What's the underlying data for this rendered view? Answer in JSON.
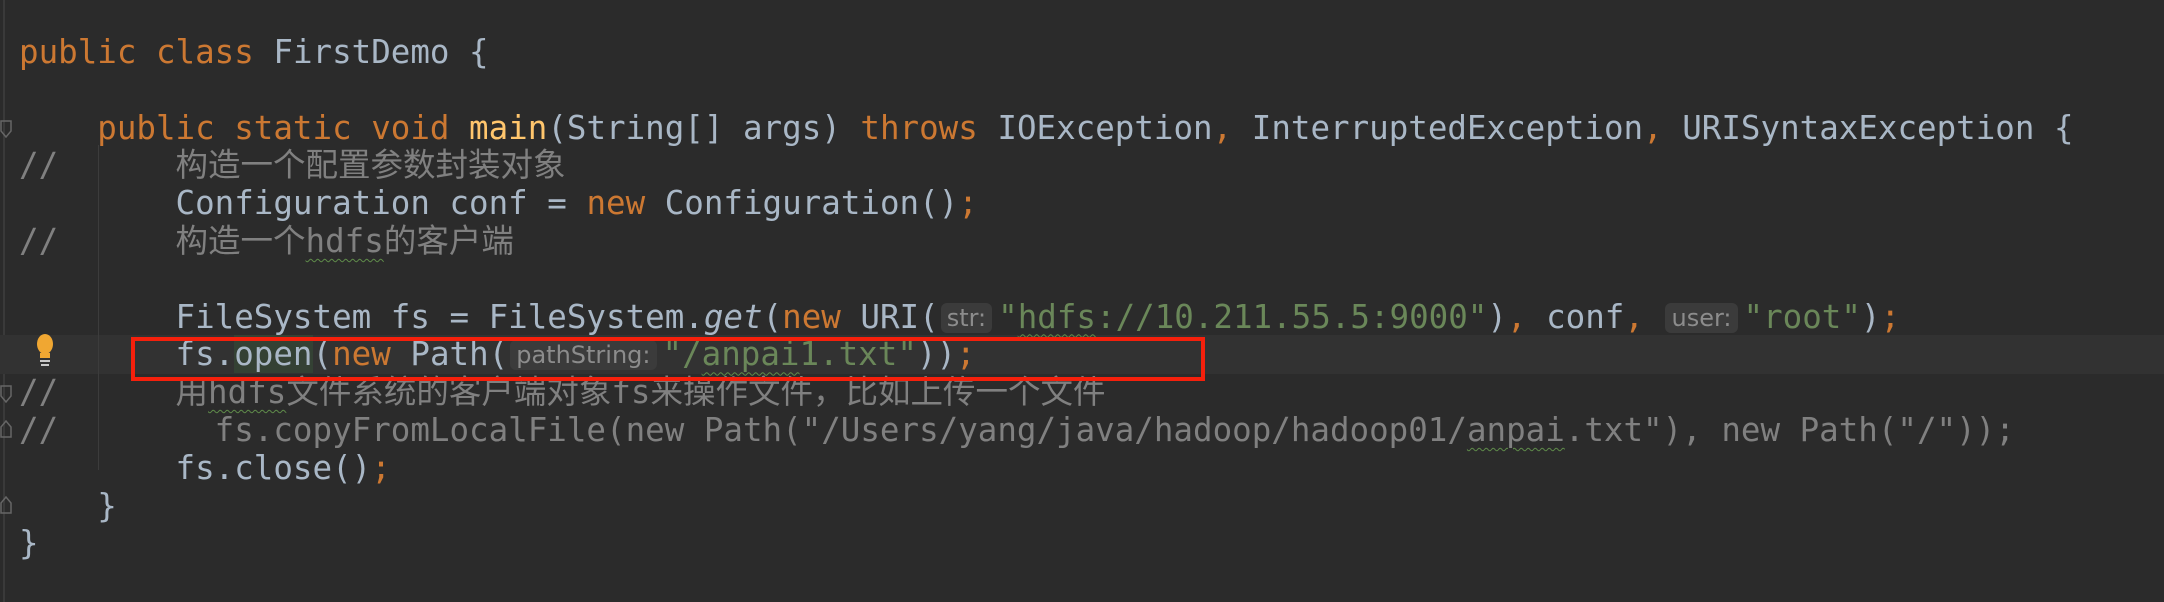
{
  "editor": {
    "colors": {
      "background": "#2b2b2b",
      "keyword": "#cc7832",
      "text": "#a9b7c6",
      "string": "#6a8759",
      "comment": "#808080",
      "method": "#ffc66d",
      "highlight_box": "#f5200c"
    },
    "lines": [
      {
        "tokens": [
          {
            "t": "public class ",
            "c": "kw"
          },
          {
            "t": "FirstDemo {"
          }
        ]
      },
      {
        "tokens": []
      },
      {
        "tokens": [
          {
            "t": "    public static void ",
            "c": "kw"
          },
          {
            "t": "main",
            "c": "fn"
          },
          {
            "t": "(String[] args) "
          },
          {
            "t": "throws ",
            "c": "kw"
          },
          {
            "t": "IOException"
          },
          {
            "t": ", ",
            "c": "kw"
          },
          {
            "t": "InterruptedException"
          },
          {
            "t": ", ",
            "c": "kw"
          },
          {
            "t": "URISyntaxException {"
          }
        ]
      },
      {
        "tokens": [
          {
            "t": "//      构造一个配置参数封装对象",
            "c": "cm"
          }
        ]
      },
      {
        "tokens": [
          {
            "t": "        Configuration conf = "
          },
          {
            "t": "new ",
            "c": "kw"
          },
          {
            "t": "Configuration()"
          },
          {
            "t": ";",
            "c": "kw"
          }
        ]
      },
      {
        "tokens": [
          {
            "t": "//      构造一个",
            "c": "cm"
          },
          {
            "t": "hdfs",
            "c": "cm typo"
          },
          {
            "t": "的客户端",
            "c": "cm"
          }
        ]
      },
      {
        "tokens": []
      },
      {
        "tokens": [
          {
            "t": "        FileSystem fs = FileSystem."
          },
          {
            "t": "get",
            "c": "it"
          },
          {
            "t": "("
          },
          {
            "t": "new ",
            "c": "kw"
          },
          {
            "t": "URI("
          },
          {
            "t": "str:",
            "c": "hint"
          },
          {
            "t": "\"",
            "c": "str"
          },
          {
            "t": "hdfs",
            "c": "str typo"
          },
          {
            "t": "://10.211.55.5:9000\"",
            "c": "str"
          },
          {
            "t": ")"
          },
          {
            "t": ", ",
            "c": "kw"
          },
          {
            "t": "conf"
          },
          {
            "t": ", ",
            "c": "kw"
          },
          {
            "t": "user:",
            "c": "hint"
          },
          {
            "t": "\"root\"",
            "c": "str"
          },
          {
            "t": ")"
          },
          {
            "t": ";",
            "c": "kw"
          }
        ]
      },
      {
        "tokens": [
          {
            "t": "        fs."
          },
          {
            "t": "open",
            "c": "hl"
          },
          {
            "t": "("
          },
          {
            "t": "new ",
            "c": "kw"
          },
          {
            "t": "Path("
          },
          {
            "t": "pathString:",
            "c": "hint"
          },
          {
            "t": "\"/",
            "c": "str"
          },
          {
            "t": "anpai",
            "c": "str typo"
          },
          {
            "t": "1.txt\"",
            "c": "str"
          },
          {
            "t": "))"
          },
          {
            "t": ";",
            "c": "kw"
          }
        ]
      },
      {
        "tokens": [
          {
            "t": "//      用",
            "c": "cm"
          },
          {
            "t": "hdfs",
            "c": "cm typo"
          },
          {
            "t": "文件系统的客户端对象fs来操作文件，比如上传一个文件",
            "c": "cm"
          }
        ]
      },
      {
        "tokens": [
          {
            "t": "//        fs.copyFromLocalFile(new Path(\"/Users/yang/java/hadoop/hadoop01/",
            "c": "cm"
          },
          {
            "t": "anpai",
            "c": "cm typo"
          },
          {
            "t": ".txt\"), new Path(\"/\"));",
            "c": "cm"
          }
        ]
      },
      {
        "tokens": [
          {
            "t": "        fs.close()"
          },
          {
            "t": ";",
            "c": "kw"
          }
        ]
      },
      {
        "tokens": [
          {
            "t": "    }"
          }
        ]
      },
      {
        "tokens": [
          {
            "t": "}"
          }
        ]
      }
    ]
  }
}
